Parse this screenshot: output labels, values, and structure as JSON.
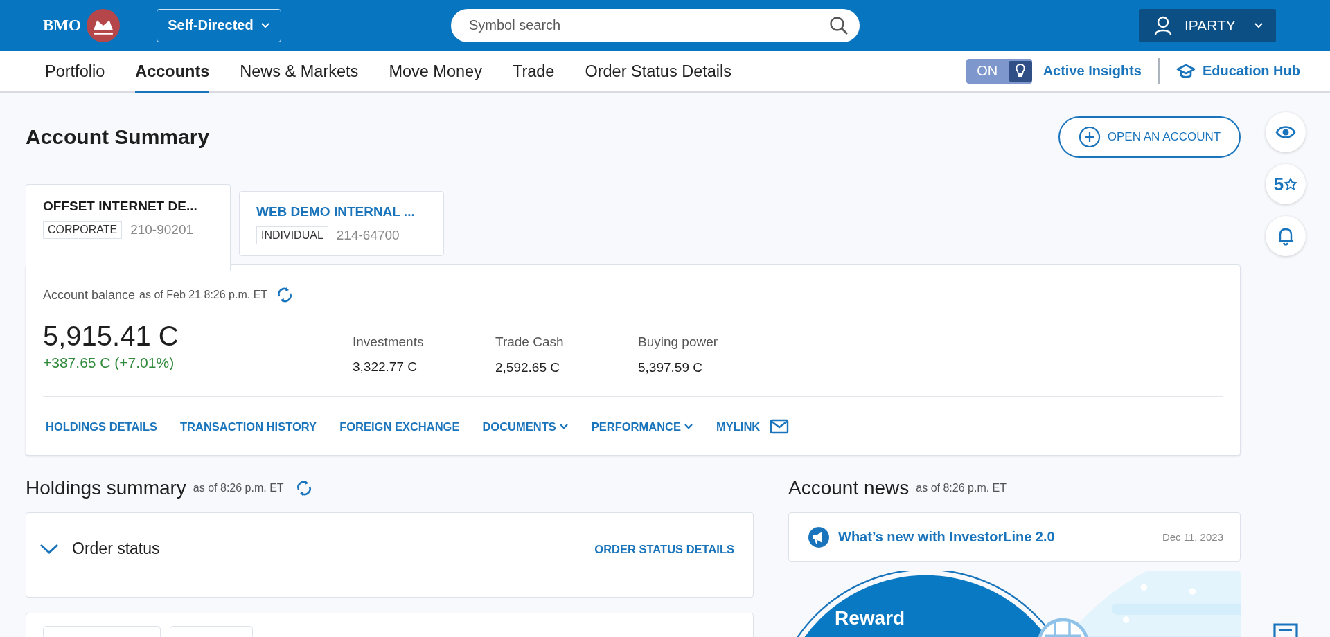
{
  "header": {
    "logo": "BMO",
    "mode": "Self-Directed",
    "search": {
      "placeholder": "Symbol search"
    },
    "user": "IPARTY"
  },
  "nav": {
    "items": [
      {
        "label": "Portfolio",
        "selected": false
      },
      {
        "label": "Accounts",
        "selected": true
      },
      {
        "label": "News & Markets",
        "selected": false
      },
      {
        "label": "Move Money",
        "selected": false
      },
      {
        "label": "Trade",
        "selected": false
      },
      {
        "label": "Order Status Details",
        "selected": false
      }
    ],
    "insights": {
      "toggle_label": "ON",
      "on": true,
      "label": "Active Insights"
    },
    "education": "Education Hub"
  },
  "page_title": "Account Summary",
  "open_account": "OPEN AN ACCOUNT",
  "accounts": [
    {
      "name": "OFFSET INTERNET DE...",
      "type": "CORPORATE",
      "number": "210-90201",
      "selected": true
    },
    {
      "name": "WEB DEMO INTERNAL ...",
      "type": "INDIVIDUAL",
      "number": "214-64700",
      "selected": false
    }
  ],
  "balance": {
    "label": "Account balance",
    "as_of": "as of Feb 21 8:26 p.m. ET",
    "amount": "5,915.41 C",
    "change": "+387.65 C (+7.01%)",
    "metrics": [
      {
        "label": "Investments",
        "value": "3,322.77 C",
        "has_tooltip": false
      },
      {
        "label": "Trade Cash",
        "value": "2,592.65 C",
        "has_tooltip": true
      },
      {
        "label": "Buying power",
        "value": "5,397.59 C",
        "has_tooltip": true
      }
    ],
    "links": [
      {
        "label": "HOLDINGS DETAILS",
        "kind": "plain"
      },
      {
        "label": "TRANSACTION HISTORY",
        "kind": "plain"
      },
      {
        "label": "FOREIGN EXCHANGE",
        "kind": "plain"
      },
      {
        "label": "DOCUMENTS",
        "kind": "dropdown"
      },
      {
        "label": "PERFORMANCE",
        "kind": "dropdown"
      },
      {
        "label": "MYLINK",
        "kind": "mail"
      }
    ]
  },
  "holdings": {
    "title": "Holdings summary",
    "as_of": "as of 8:26 p.m. ET",
    "order_status": {
      "title": "Order status",
      "expanded": true,
      "link": "ORDER STATUS DETAILS"
    }
  },
  "news": {
    "title": "Account news",
    "as_of": "as of 8:26 p.m. ET",
    "items": [
      {
        "title": "What’s new with InvestorLine 2.0",
        "date": "Dec 11, 2023"
      }
    ],
    "promo": {
      "headline": "Reward"
    }
  },
  "rail": [
    {
      "kind": "eye"
    },
    {
      "kind": "rating",
      "label": "5"
    },
    {
      "kind": "bell"
    }
  ]
}
